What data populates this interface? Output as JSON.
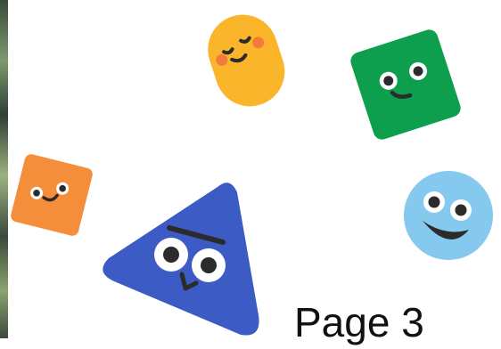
{
  "page": {
    "label": "Page 3"
  },
  "characters": [
    {
      "name": "yellow-pill",
      "color": "#FBB52B",
      "expression": "sleepy-happy"
    },
    {
      "name": "green-square",
      "color": "#0E9F4E",
      "expression": "smile"
    },
    {
      "name": "orange-square",
      "color": "#F58E3A",
      "expression": "smile"
    },
    {
      "name": "blue-triangle",
      "color": "#3C5BC5",
      "expression": "grumpy"
    },
    {
      "name": "light-blue-circle",
      "color": "#86C9EE",
      "expression": "grin"
    }
  ],
  "colors": {
    "background": "#FFFFFF",
    "face": "#2B2B2B",
    "cheek": "#F27A3B"
  }
}
